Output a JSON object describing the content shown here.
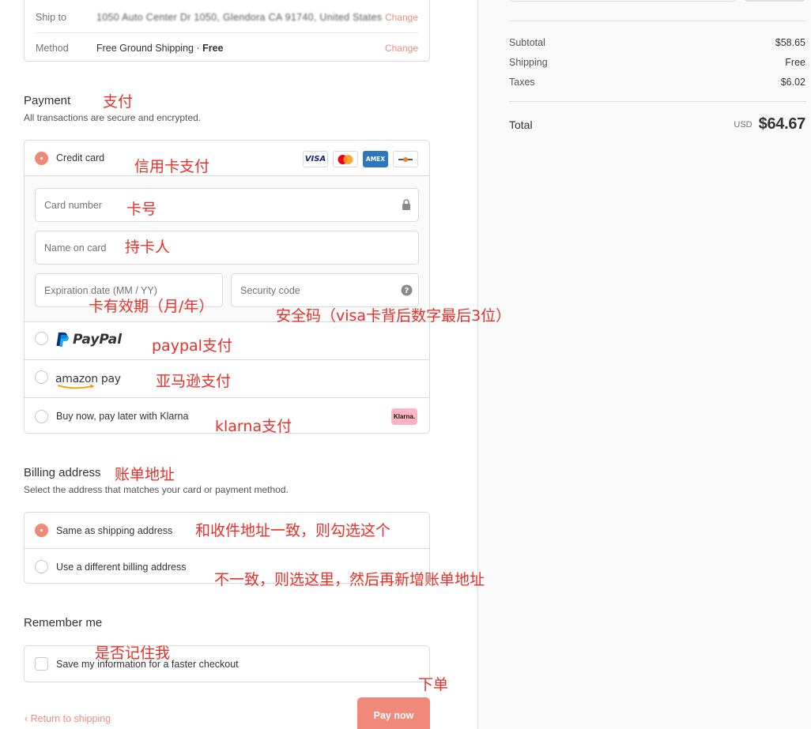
{
  "shipping": {
    "ship_to_label": "Ship to",
    "ship_to_value": "1050 Auto Center Dr 1050, Glendora CA 91740, United States",
    "method_label": "Method",
    "method_value": "Free Ground Shipping",
    "method_price": "Free",
    "change_label": "Change"
  },
  "payment": {
    "title": "Payment",
    "subtitle": "All transactions are secure and encrypted.",
    "credit_card_label": "Credit card",
    "card_brands": [
      "VISA",
      "mastercard",
      "AMEX",
      "discover"
    ],
    "card_number_placeholder": "Card number",
    "name_on_card_placeholder": "Name on card",
    "expiration_placeholder": "Expiration date (MM / YY)",
    "security_code_placeholder": "Security code",
    "security_help_glyph": "?",
    "paypal_logo_text": "PayPal",
    "amazon_logo_text": "amazon pay",
    "klarna_label": "Buy now, pay later with Klarna",
    "klarna_badge": "Klarna."
  },
  "billing": {
    "title": "Billing address",
    "subtitle": "Select the address that matches your card or payment method.",
    "same_label": "Same as shipping address",
    "different_label": "Use a different billing address"
  },
  "remember": {
    "title": "Remember me",
    "save_label": "Save my information for a faster checkout"
  },
  "footer": {
    "return_label": "Return to shipping",
    "pay_label": "Pay now"
  },
  "summary": {
    "subtotal_label": "Subtotal",
    "subtotal_value": "$58.65",
    "shipping_label": "Shipping",
    "shipping_value": "Free",
    "taxes_label": "Taxes",
    "taxes_value": "$6.02",
    "total_label": "Total",
    "currency": "USD",
    "total_value": "$64.67"
  },
  "annotations": {
    "payment": "支付",
    "credit_card": "信用卡支付",
    "card_number": "卡号",
    "cardholder": "持卡人",
    "expiry": "卡有效期（月/年）",
    "security": "安全码（visa卡背后数字最后3位）",
    "paypal": "paypal支付",
    "amazon": "亚马逊支付",
    "klarna": "klarna支付",
    "billing": "账单地址",
    "same": "和收件地址一致，则勾选这个",
    "different": "不一致，则选这里，然后再新增账单地址",
    "remember": "是否记住我",
    "order": "下单"
  },
  "colors": {
    "accent": "#ef8a79",
    "annotation": "#e8302a"
  },
  "icons": {
    "lock": "lock-icon",
    "help": "question-circle-icon",
    "back": "chevron-left-icon"
  }
}
